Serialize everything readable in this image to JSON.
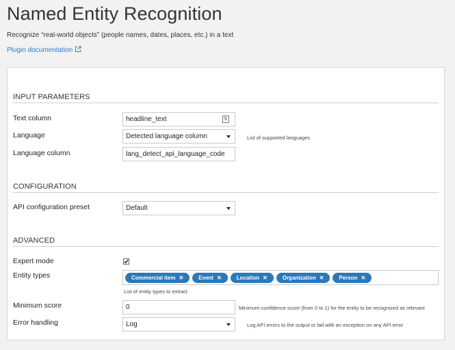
{
  "header": {
    "title": "Named Entity Recognition",
    "subtitle": "Recognize “real-world objects” (people names, dates, places, etc.) in a text",
    "doc_link": "Plugin documentation"
  },
  "sections": {
    "input": "INPUT PARAMETERS",
    "config": "CONFIGURATION",
    "advanced": "ADVANCED"
  },
  "fields": {
    "text_column": {
      "label": "Text column",
      "value": "headline_text"
    },
    "language": {
      "label": "Language",
      "value": "Detected language column",
      "hint": "List of supported languages"
    },
    "language_column": {
      "label": "Language column",
      "value": "lang_detect_api_language_code"
    },
    "api_preset": {
      "label": "API configuration preset",
      "value": "Default"
    },
    "expert_mode": {
      "label": "Expert mode",
      "checked": true
    },
    "entity_types": {
      "label": "Entity types",
      "hint": "List of entity types to extract",
      "tags": [
        "Commercial item",
        "Event",
        "Location",
        "Organization",
        "Person"
      ]
    },
    "min_score": {
      "label": "Minimum score",
      "value": "0",
      "hint": "Minimum confidence score (from 0 to 1) for the entity to be recognized as relevant"
    },
    "error_handling": {
      "label": "Error handling",
      "value": "Log",
      "hint": "Log API errors to the output or fail with an exception on any API error"
    }
  },
  "colors": {
    "accent": "#2c79b8",
    "link": "#2a7cc7"
  }
}
